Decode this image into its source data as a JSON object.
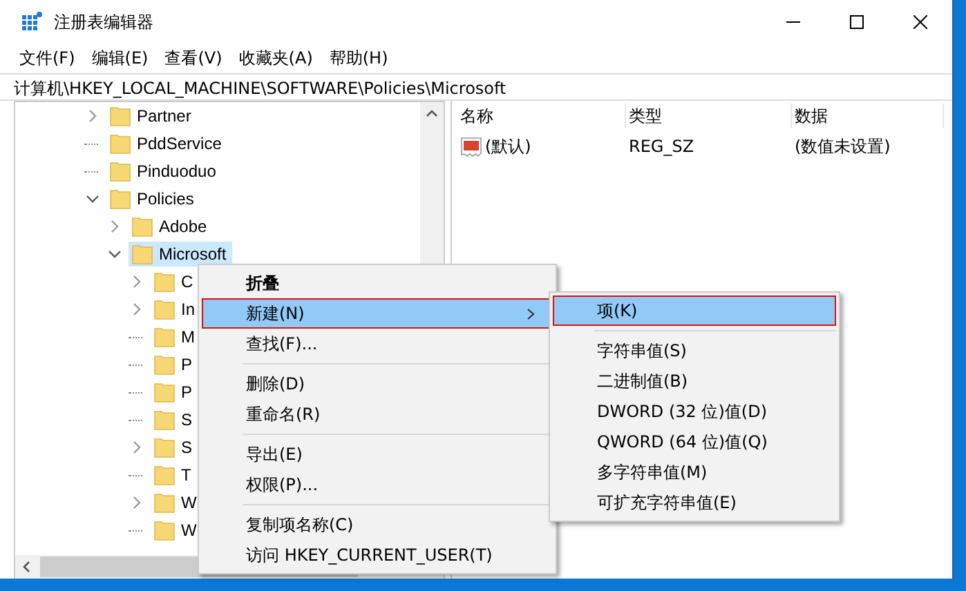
{
  "window": {
    "title": "注册表编辑器"
  },
  "menu_bar": [
    "文件(F)",
    "编辑(E)",
    "查看(V)",
    "收藏夹(A)",
    "帮助(H)"
  ],
  "address": "计算机\\HKEY_LOCAL_MACHINE\\SOFTWARE\\Policies\\Microsoft",
  "tree": [
    {
      "label": "Partner",
      "expanded": false,
      "selected": false
    },
    {
      "label": "PddService",
      "selected": false
    },
    {
      "label": "Pinduoduo",
      "selected": false
    },
    {
      "label": "Policies",
      "expanded": true,
      "selected": false,
      "children": [
        {
          "label": "Adobe",
          "expanded": false,
          "selected": false
        },
        {
          "label": "Microsoft",
          "expanded": true,
          "selected": true,
          "children": [
            {
              "label": "C",
              "expanded": false,
              "selected": false
            },
            {
              "label": "In",
              "expanded": false,
              "selected": false
            },
            {
              "label": "M",
              "selected": false
            },
            {
              "label": "P",
              "selected": false
            },
            {
              "label": "P",
              "selected": false
            },
            {
              "label": "S",
              "selected": false
            },
            {
              "label": "S",
              "expanded": false,
              "selected": false
            },
            {
              "label": "T",
              "selected": false
            },
            {
              "label": "W",
              "expanded": false,
              "selected": false
            },
            {
              "label": "W",
              "selected": false
            }
          ]
        }
      ]
    }
  ],
  "values": {
    "columns": [
      "名称",
      "类型",
      "数据"
    ],
    "rows": [
      {
        "name": "(默认)",
        "type": "REG_SZ",
        "data": "(数值未设置)"
      }
    ]
  },
  "context_menu": {
    "items": [
      {
        "kind": "default",
        "label": "折叠",
        "selected": false
      },
      {
        "kind": "item",
        "label": "新建(N)",
        "selected": true,
        "submenu": true,
        "outlined": true
      },
      {
        "kind": "item",
        "label": "查找(F)...",
        "selected": false
      },
      {
        "kind": "separator"
      },
      {
        "kind": "item",
        "label": "删除(D)",
        "selected": false
      },
      {
        "kind": "item",
        "label": "重命名(R)",
        "selected": false
      },
      {
        "kind": "separator"
      },
      {
        "kind": "item",
        "label": "导出(E)",
        "selected": false
      },
      {
        "kind": "item",
        "label": "权限(P)...",
        "selected": false
      },
      {
        "kind": "separator"
      },
      {
        "kind": "item",
        "label": "复制项名称(C)",
        "selected": false
      },
      {
        "kind": "item",
        "label": "访问 HKEY_CURRENT_USER(T)",
        "selected": false
      }
    ]
  },
  "submenu": {
    "items": [
      {
        "kind": "item",
        "label": "项(K)",
        "selected": true,
        "outlined": true
      },
      {
        "kind": "separator"
      },
      {
        "kind": "item",
        "label": "字符串值(S)",
        "selected": false
      },
      {
        "kind": "item",
        "label": "二进制值(B)",
        "selected": false
      },
      {
        "kind": "item",
        "label": "DWORD (32 位)值(D)",
        "selected": false
      },
      {
        "kind": "item",
        "label": "QWORD (64 位)值(Q)",
        "selected": false
      },
      {
        "kind": "item",
        "label": "多字符串值(M)",
        "selected": false
      },
      {
        "kind": "item",
        "label": "可扩充字符串值(E)",
        "selected": false
      }
    ]
  }
}
